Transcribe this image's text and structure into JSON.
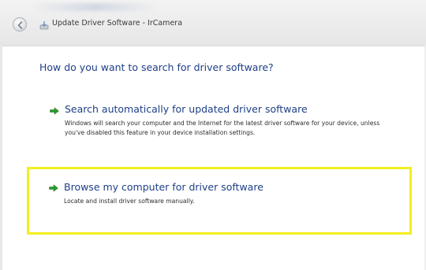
{
  "window": {
    "title": "Update Driver Software - IrCamera"
  },
  "main": {
    "heading": "How do you want to search for driver software?",
    "options": [
      {
        "title": "Search automatically for updated driver software",
        "description": "Windows will search your computer and the Internet for the latest driver software for your device, unless you've disabled this feature in your device installation settings."
      },
      {
        "title": "Browse my computer for driver software",
        "description": "Locate and install driver software manually.",
        "highlighted": true
      }
    ]
  },
  "icons": {
    "back": "back-arrow-icon",
    "title": "driver-install-icon",
    "option_arrow": "green-arrow-icon"
  },
  "colors": {
    "heading_blue": "#1e3f87",
    "highlight_yellow": "#f2ef1e",
    "arrow_green": "#2a9a2a"
  }
}
